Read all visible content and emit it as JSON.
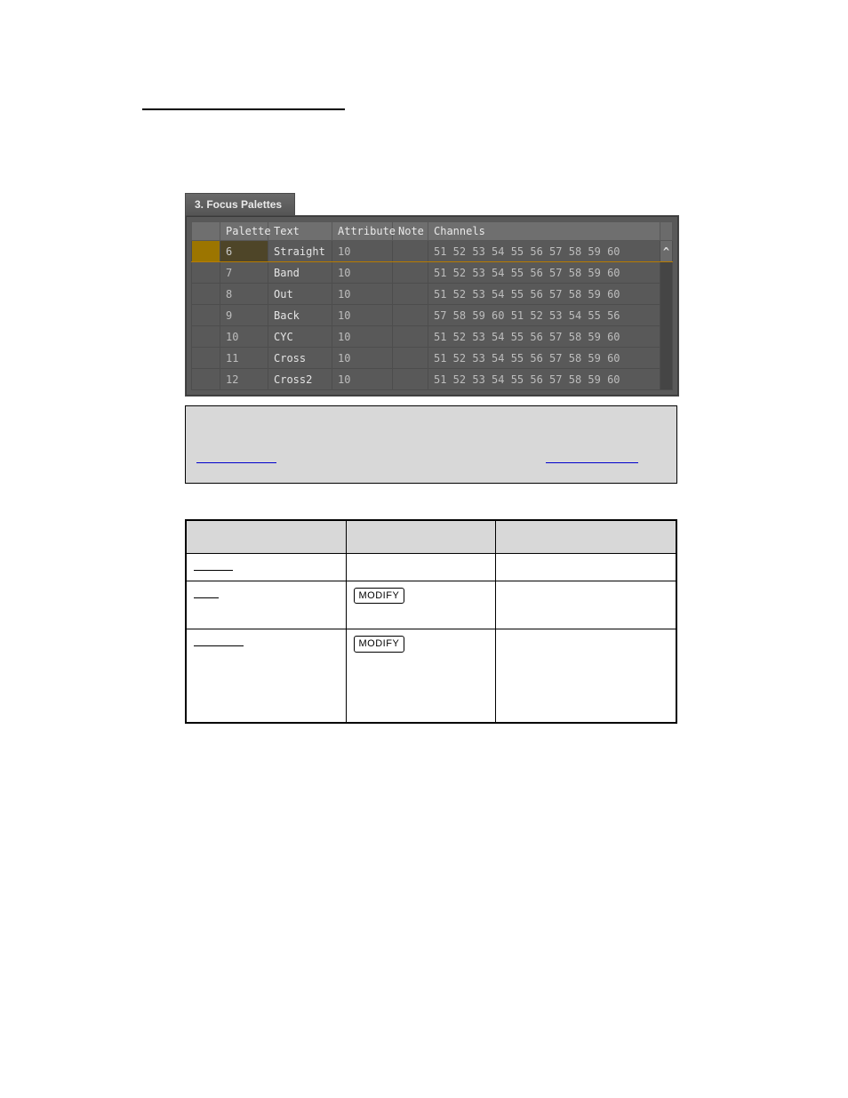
{
  "section_underline_present": true,
  "panel": {
    "title": "3. Focus Palettes",
    "columns": {
      "palette": "Palette",
      "text": "Text",
      "attribute": "Attribute",
      "note": "Note",
      "channels": "Channels"
    },
    "scroll_glyph": "^",
    "rows": [
      {
        "palette": "6",
        "text": "Straight",
        "attribute": "10",
        "note": "",
        "channels": "51 52 53 54 55 56 57 58 59 60",
        "selected": true
      },
      {
        "palette": "7",
        "text": "Band",
        "attribute": "10",
        "note": "",
        "channels": "51 52 53 54 55 56 57 58 59 60",
        "selected": false
      },
      {
        "palette": "8",
        "text": "Out",
        "attribute": "10",
        "note": "",
        "channels": "51 52 53 54 55 56 57 58 59 60",
        "selected": false
      },
      {
        "palette": "9",
        "text": "Back",
        "attribute": "10",
        "note": "",
        "channels": "57 58 59 60 51 52 53 54 55 56",
        "selected": false
      },
      {
        "palette": "10",
        "text": "CYC",
        "attribute": "10",
        "note": "",
        "channels": "51 52 53 54 55 56 57 58 59 60",
        "selected": false
      },
      {
        "palette": "11",
        "text": "Cross",
        "attribute": "10",
        "note": "",
        "channels": "51 52 53 54 55 56 57 58 59 60",
        "selected": false
      },
      {
        "palette": "12",
        "text": "Cross2",
        "attribute": "10",
        "note": "",
        "channels": "51 52 53 54 55 56 57 58 59 60",
        "selected": false
      }
    ]
  },
  "note_box": {
    "line1_a": "",
    "line1_b": "",
    "link1": "",
    "link2": ""
  },
  "desc_table": {
    "rows": [
      {
        "label": "",
        "key": "",
        "desc": "",
        "underline_w": 44
      },
      {
        "label": "",
        "key": "MODIFY",
        "desc": "",
        "underline_w": 28
      },
      {
        "label": "",
        "key": "MODIFY",
        "desc": "",
        "underline_w": 56
      }
    ]
  }
}
